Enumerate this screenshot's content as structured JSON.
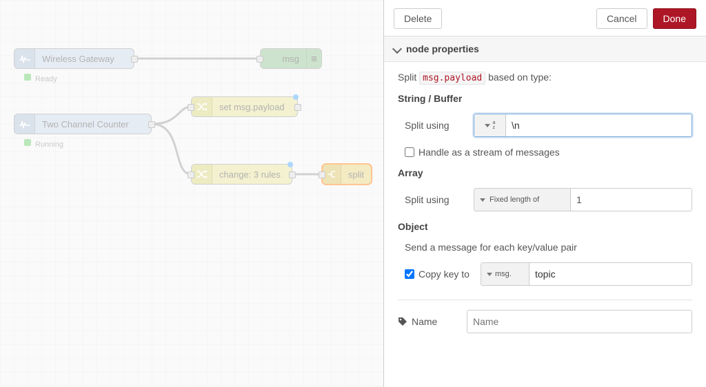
{
  "canvas": {
    "nodes": {
      "gateway": {
        "label": "Wireless Gateway",
        "status": "Ready"
      },
      "counter": {
        "label": "Two Channel Counter",
        "status": "Running"
      },
      "msg": {
        "label": "msg"
      },
      "set_payload": {
        "label": "set msg.payload"
      },
      "change3": {
        "label": "change: 3 rules"
      },
      "split": {
        "label": "split"
      }
    }
  },
  "sidebar": {
    "buttons": {
      "delete": "Delete",
      "cancel": "Cancel",
      "done": "Done"
    },
    "title": "node properties",
    "intro_pre": "Split",
    "intro_code": "msg.payload",
    "intro_post": "based on type:",
    "string_section": {
      "head": "String / Buffer",
      "label": "Split using",
      "type_hint": "a z",
      "value": "\\n",
      "stream_label": "Handle as a stream of messages",
      "stream_checked": false
    },
    "array_section": {
      "head": "Array",
      "label": "Split using",
      "mode": "Fixed length of",
      "value": "1"
    },
    "object_section": {
      "head": "Object",
      "hint": "Send a message for each key/value pair",
      "copy_label": "Copy key to",
      "copy_checked": true,
      "msg_prefix": "msg.",
      "msg_value": "topic"
    },
    "name": {
      "label": "Name",
      "placeholder": "Name",
      "value": ""
    }
  }
}
